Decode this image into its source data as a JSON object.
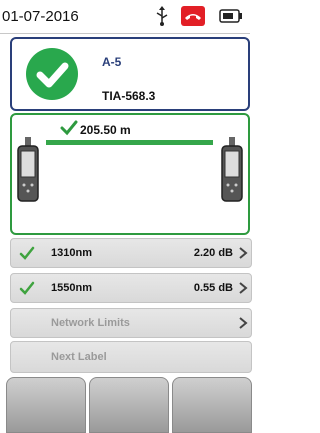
{
  "status_bar": {
    "date": "01-07-2016",
    "icons": [
      "usb-icon",
      "phone-hangup-icon",
      "battery-icon"
    ],
    "alert_color": "#e21f26"
  },
  "result": {
    "status_icon": "pass-check-icon",
    "status_color": "#29a84d",
    "cable_id": "A-5",
    "standard": "TIA-568.3"
  },
  "link": {
    "length": "205.50 m",
    "line_color": "#35a64a"
  },
  "measurements": [
    {
      "wavelength": "1310nm",
      "value": "2.20 dB"
    },
    {
      "wavelength": "1550nm",
      "value": "0.55 dB"
    }
  ],
  "network_limits_label": "Network Limits",
  "next_label": "Next Label",
  "softkeys": [
    "",
    "",
    ""
  ]
}
